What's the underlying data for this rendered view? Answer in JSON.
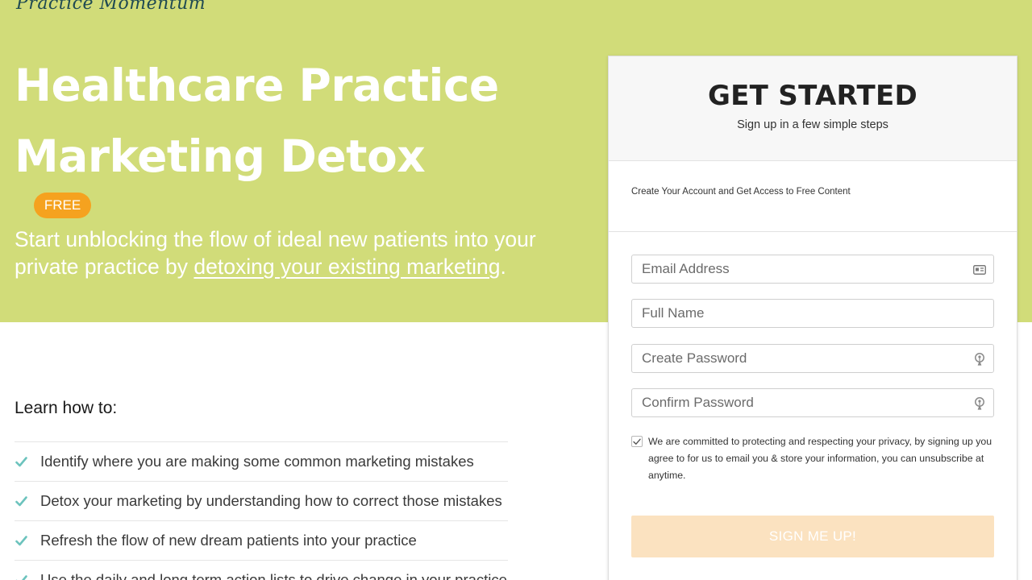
{
  "brand": {
    "logo_text": "Practice Momentum"
  },
  "hero": {
    "title": "Healthcare Practice Marketing Detox",
    "badge": "FREE",
    "subtitle_prefix": "Start unblocking the flow of ideal new patients into your private practice by ",
    "subtitle_link": "detoxing your existing marketing",
    "subtitle_suffix": "."
  },
  "learn": {
    "heading": "Learn how to:",
    "items": [
      {
        "label": "Identify where you are making some common marketing mistakes"
      },
      {
        "label": "Detox your marketing by understanding how to correct those mistakes"
      },
      {
        "label": "Refresh the flow of new dream patients into your practice"
      },
      {
        "label": "Use the daily and long term action lists to drive change in your practice"
      }
    ]
  },
  "signup": {
    "title": "GET STARTED",
    "subtitle": "Sign up in a few simple steps",
    "description": "Create Your Account and Get Access to Free Content",
    "fields": {
      "email": {
        "placeholder": "Email Address",
        "icon": "contact-card-icon"
      },
      "full_name": {
        "placeholder": "Full Name"
      },
      "password": {
        "placeholder": "Create Password",
        "icon": "key-icon"
      },
      "confirm_password": {
        "placeholder": "Confirm Password",
        "icon": "key-icon"
      }
    },
    "consent_checked": true,
    "consent_text": "We are committed to protecting and respecting your privacy, by signing up you agree to for us to email you & store your information, you can unsubscribe at anytime.",
    "submit_label": "SIGN ME UP!"
  },
  "colors": {
    "hero_bg": "#d1dc79",
    "badge_bg": "#f5a21f",
    "check": "#6cc3bd",
    "submit_bg": "#fbe2c0"
  }
}
